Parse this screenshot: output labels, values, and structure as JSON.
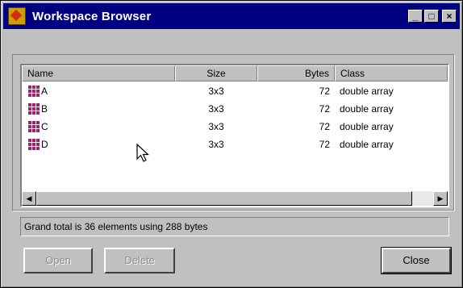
{
  "window": {
    "title": "Workspace Browser",
    "title_buttons": {
      "minimize": "_",
      "maximize": "□",
      "close": "×"
    }
  },
  "table": {
    "columns": {
      "name": "Name",
      "size": "Size",
      "bytes": "Bytes",
      "class": "Class"
    },
    "rows": [
      {
        "name": "A",
        "size": "3x3",
        "bytes": "72",
        "class": "double array"
      },
      {
        "name": "B",
        "size": "3x3",
        "bytes": "72",
        "class": "double array"
      },
      {
        "name": "C",
        "size": "3x3",
        "bytes": "72",
        "class": "double array"
      },
      {
        "name": "D",
        "size": "3x3",
        "bytes": "72",
        "class": "double array"
      }
    ],
    "row_icon": "matrix-variable-icon"
  },
  "scrollbar": {
    "left_arrow": "◀",
    "right_arrow": "▶"
  },
  "status": {
    "text": "Grand total is 36 elements using 288 bytes"
  },
  "buttons": {
    "open": "Open",
    "delete": "Delete",
    "close": "Close"
  },
  "colors": {
    "titlebar": "#000080",
    "window": "#c0c0c0",
    "matrix_icon": "#a0206a"
  }
}
